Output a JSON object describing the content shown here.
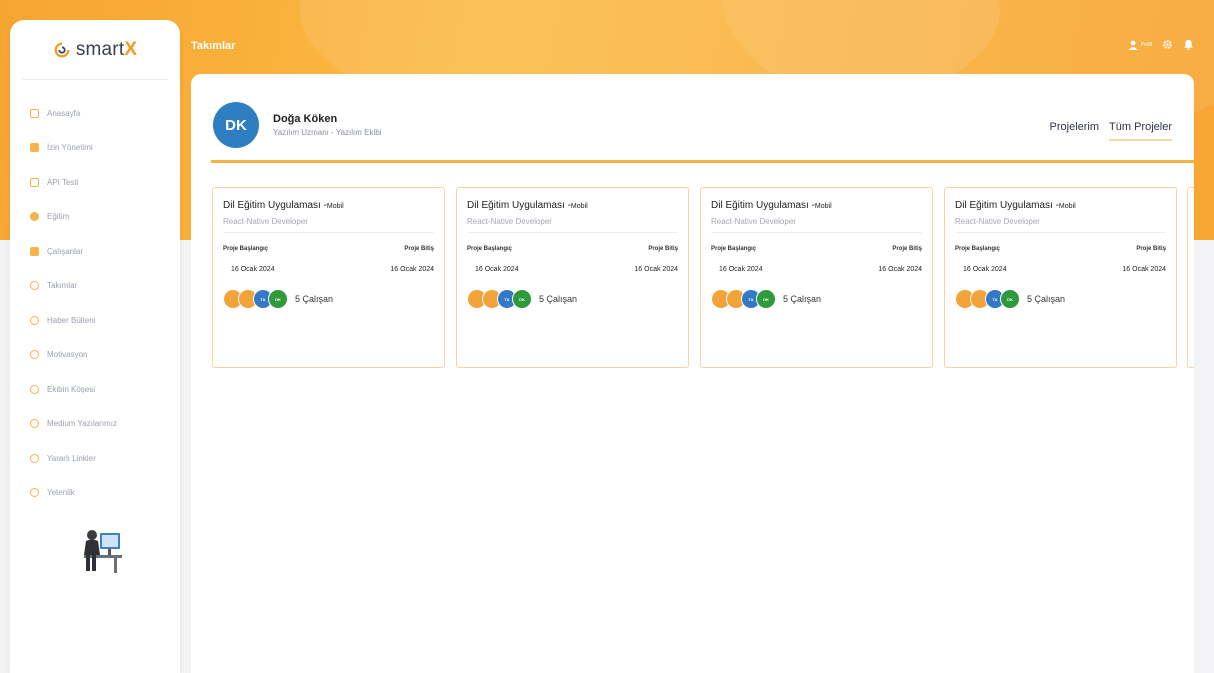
{
  "app": {
    "logo_prefix": "smart",
    "logo_suffix": "X"
  },
  "topbar": {
    "title": "Takımlar",
    "profile_label": "Profil"
  },
  "sidebar": {
    "items": [
      {
        "label": "Anasayfa",
        "icon": "home-icon"
      },
      {
        "label": "İzin Yönetimi",
        "icon": "calendar-icon"
      },
      {
        "label": "API Testi",
        "icon": "code-icon"
      },
      {
        "label": "Eğitim",
        "icon": "education-icon"
      },
      {
        "label": "Çalışanlar",
        "icon": "employees-icon"
      },
      {
        "label": "Takımlar",
        "icon": "team-icon"
      },
      {
        "label": "Haber Bülteni",
        "icon": "newsletter-icon"
      },
      {
        "label": "Motivasyon",
        "icon": "motivation-icon"
      },
      {
        "label": "Ekibin Köşesi",
        "icon": "corner-icon"
      },
      {
        "label": "Medium Yazılarımız",
        "icon": "medium-icon"
      },
      {
        "label": "Yararlı Linkler",
        "icon": "link-icon"
      },
      {
        "label": "Yetenlik",
        "icon": "skill-icon"
      }
    ]
  },
  "user": {
    "initials": "DK",
    "name": "Doğa Köken",
    "role": "Yazılım Uzmanı - Yazılım Ekibi"
  },
  "tabs": [
    {
      "label": "Projelerim"
    },
    {
      "label": "Tüm Projeler",
      "active": true
    }
  ],
  "cards": [
    {
      "title": "Dil Eğitim Uygulaması -",
      "title_sub": "Mobil",
      "role": "React-Native Developer",
      "start_label": "Proje Başlangıç",
      "end_label": "Proje Bitiş",
      "start_date": "16 Ocak 2024",
      "end_date": "16 Ocak 2024",
      "avatars": [
        "",
        "",
        "TA",
        "DK"
      ],
      "team_count": "5 Çalışan"
    },
    {
      "title": "Dil Eğitim Uygulaması -",
      "title_sub": "Mobil",
      "role": "React-Native Developer",
      "start_label": "Proje Başlangıç",
      "end_label": "Proje Bitiş",
      "start_date": "16 Ocak 2024",
      "end_date": "16 Ocak 2024",
      "avatars": [
        "",
        "",
        "TA",
        "DK"
      ],
      "team_count": "5 Çalışan"
    },
    {
      "title": "Dil Eğitim Uygulaması -",
      "title_sub": "Mobil",
      "role": "React-Native Developer",
      "start_label": "Proje Başlangıç",
      "end_label": "Proje Bitiş",
      "start_date": "16 Ocak 2024",
      "end_date": "16 Ocak 2024",
      "avatars": [
        "",
        "",
        "TA",
        "DK"
      ],
      "team_count": "5 Çalışan"
    },
    {
      "title": "Dil Eğitim Uygulaması -",
      "title_sub": "Mobil",
      "role": "React-Native Developer",
      "start_label": "Proje Başlangıç",
      "end_label": "Proje Bitiş",
      "start_date": "16 Ocak 2024",
      "end_date": "16 Ocak 2024",
      "avatars": [
        "",
        "",
        "TA",
        "DK"
      ],
      "team_count": "5 Çalışan"
    }
  ],
  "colors": {
    "accent": "#f5a623",
    "avatar_blue": "#2e7fc2",
    "team_green": "#2e9a3c"
  }
}
